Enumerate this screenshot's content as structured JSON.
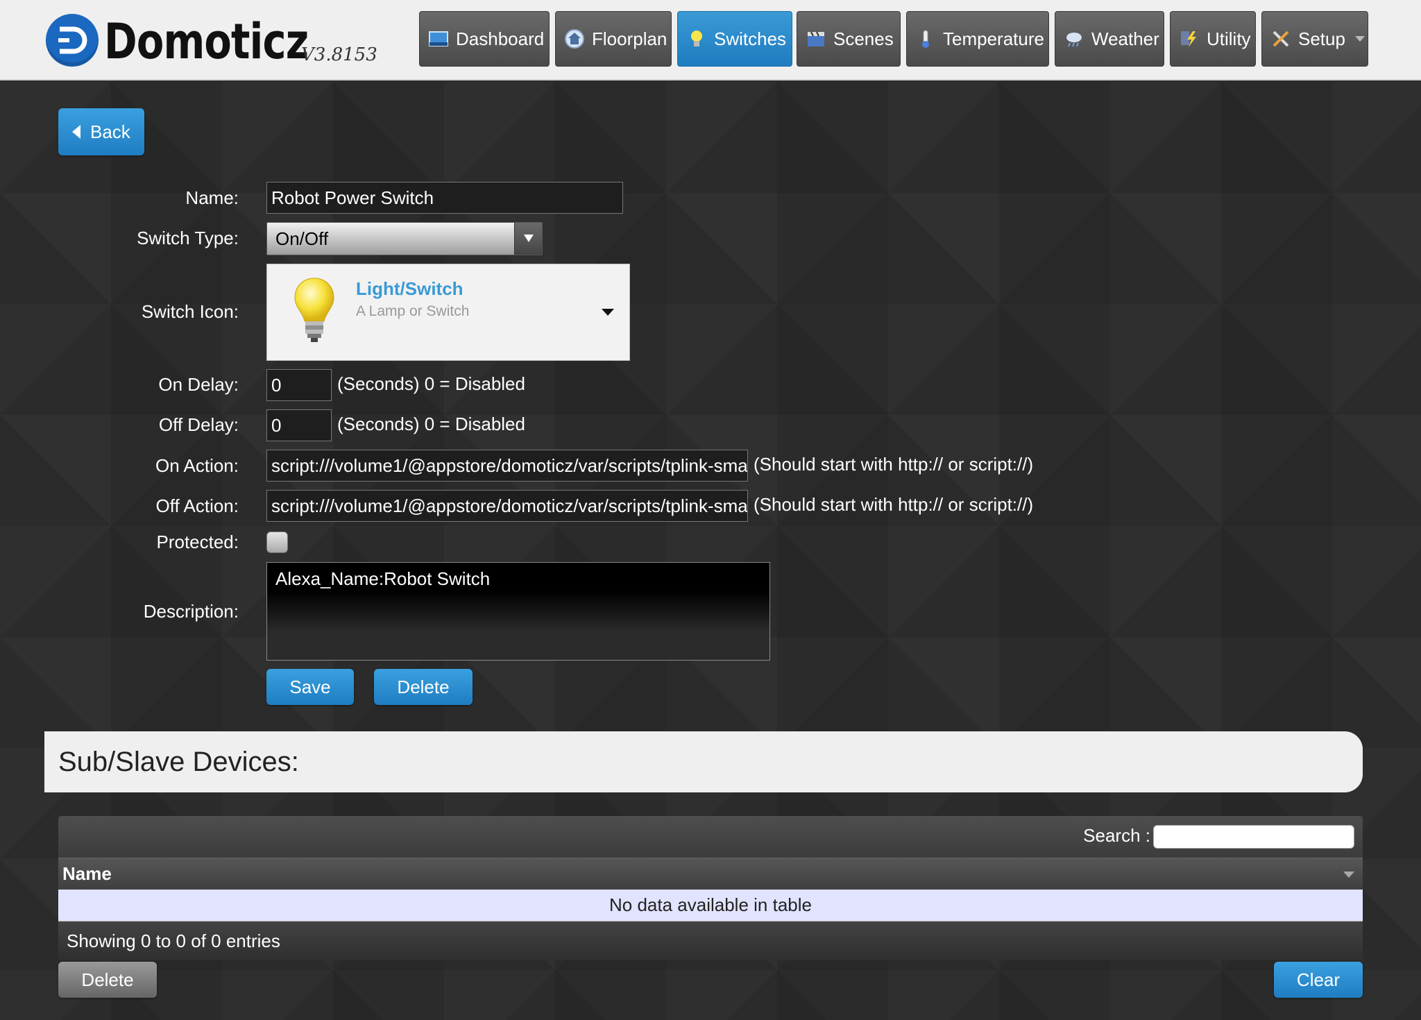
{
  "app": {
    "logo_text": "Domoticz",
    "version": "V3.8153"
  },
  "nav": {
    "items": [
      {
        "label": "Dashboard",
        "icon": "dashboard-icon"
      },
      {
        "label": "Floorplan",
        "icon": "floorplan-icon"
      },
      {
        "label": "Switches",
        "icon": "lightbulb-icon",
        "active": true
      },
      {
        "label": "Scenes",
        "icon": "clapperboard-icon"
      },
      {
        "label": "Temperature",
        "icon": "thermometer-icon"
      },
      {
        "label": "Weather",
        "icon": "cloud-rain-icon"
      },
      {
        "label": "Utility",
        "icon": "lightning-icon"
      },
      {
        "label": "Setup",
        "icon": "tools-icon",
        "has_dropdown": true
      }
    ]
  },
  "back_label": "Back",
  "form": {
    "name_label": "Name:",
    "name_value": "Robot Power Switch",
    "switch_type_label": "Switch Type:",
    "switch_type_value": "On/Off",
    "switch_icon_label": "Switch Icon:",
    "switch_icon_title": "Light/Switch",
    "switch_icon_subtitle": "A Lamp or Switch",
    "on_delay_label": "On Delay:",
    "on_delay_value": "0",
    "on_delay_hint": "(Seconds) 0 = Disabled",
    "off_delay_label": "Off Delay:",
    "off_delay_value": "0",
    "off_delay_hint": "(Seconds) 0 = Disabled",
    "on_action_label": "On Action:",
    "on_action_value": "script:///volume1/@appstore/domoticz/var/scripts/tplink-sma",
    "on_action_hint": "(Should start with http:// or script://)",
    "off_action_label": "Off Action:",
    "off_action_value": "script:///volume1/@appstore/domoticz/var/scripts/tplink-sma",
    "off_action_hint": "(Should start with http:// or script://)",
    "protected_label": "Protected:",
    "protected_checked": false,
    "description_label": "Description:",
    "description_value": "Alexa_Name:Robot Switch",
    "save_label": "Save",
    "delete_label": "Delete"
  },
  "subdevices": {
    "title": "Sub/Slave Devices:",
    "search_label": "Search :",
    "search_value": "",
    "column_name": "Name",
    "empty_text": "No data available in table",
    "info_text": "Showing 0 to 0 of 0 entries",
    "delete_label": "Delete",
    "clear_label": "Clear"
  },
  "colors": {
    "accent_blue": "#2489cc",
    "background": "#2b2b2b",
    "header_bg": "#efefef",
    "link_blue": "#3a9ad6"
  }
}
